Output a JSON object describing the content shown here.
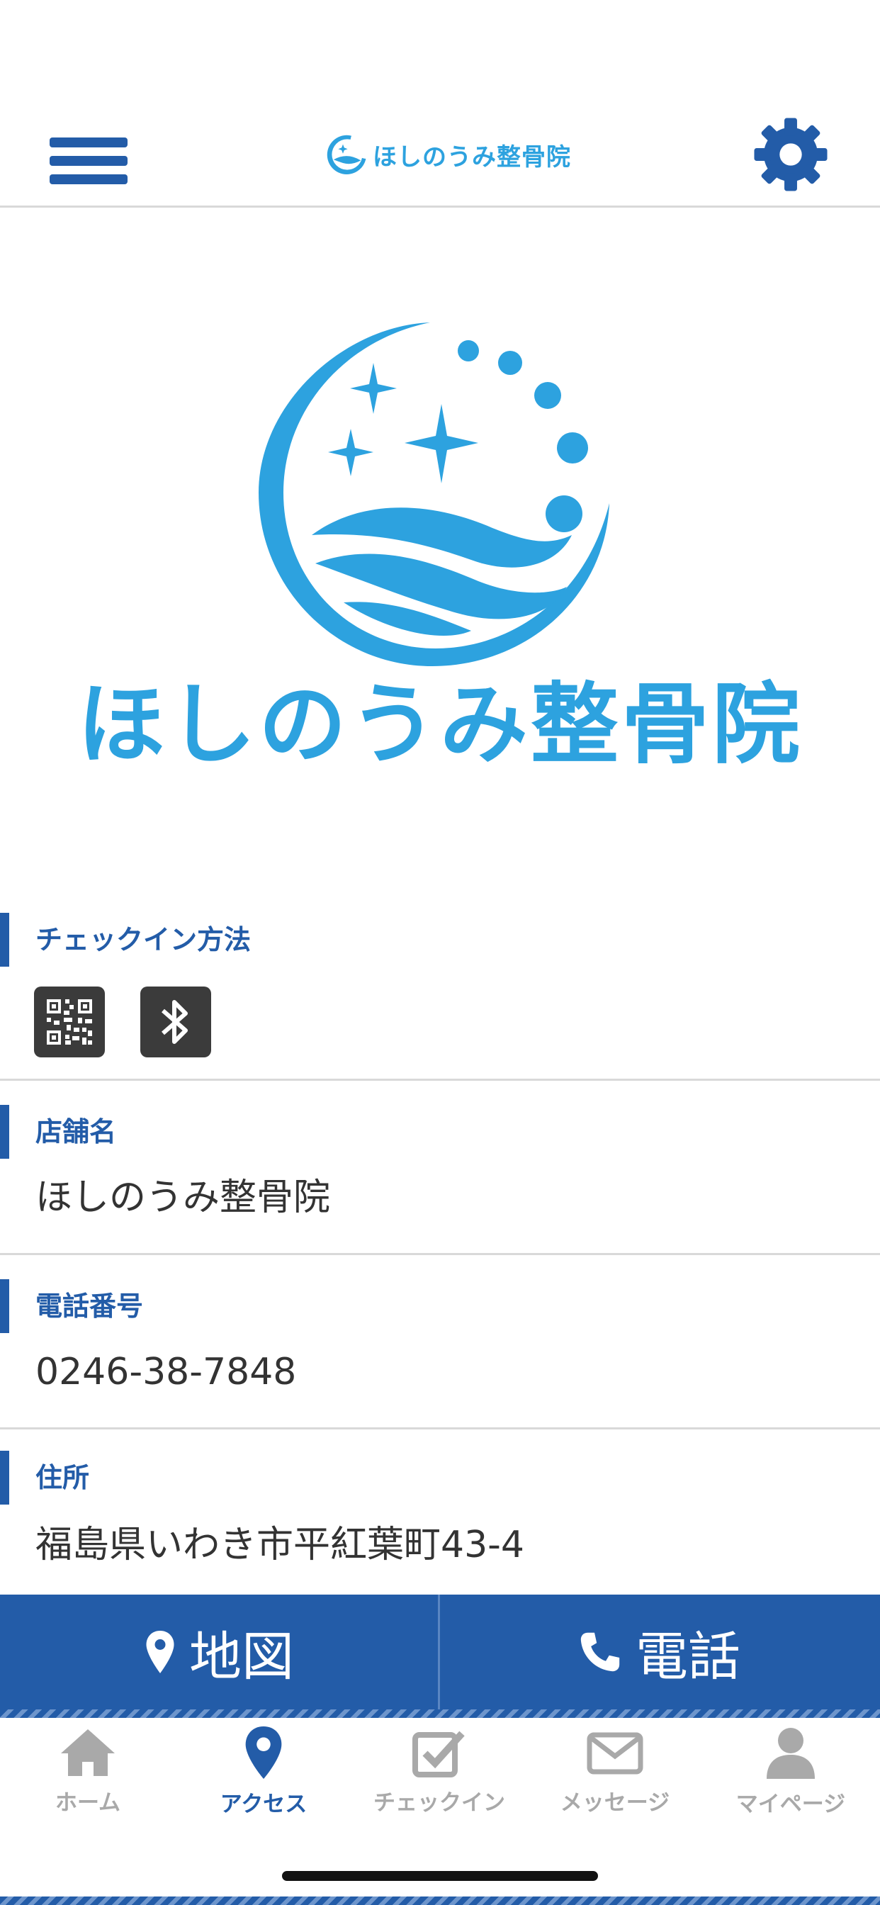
{
  "header": {
    "logo_text": "ほしのうみ整骨院"
  },
  "hero": {
    "clinic_name": "ほしのうみ整骨院"
  },
  "sections": {
    "checkin": {
      "label": "チェックイン方法",
      "methods": [
        "qr-code-icon",
        "bluetooth-icon"
      ]
    },
    "store_name": {
      "label": "店舗名",
      "value": "ほしのうみ整骨院"
    },
    "phone": {
      "label": "電話番号",
      "value": "0246-38-7848"
    },
    "address": {
      "label": "住所",
      "value": "福島県いわき市平紅葉町43-4"
    }
  },
  "actions": {
    "map_label": "地図",
    "call_label": "電話"
  },
  "tabs": [
    {
      "label": "ホーム",
      "icon": "home-icon",
      "active": false
    },
    {
      "label": "アクセス",
      "icon": "map-pin-icon",
      "active": true
    },
    {
      "label": "チェックイン",
      "icon": "checkbox-icon",
      "active": false
    },
    {
      "label": "メッセージ",
      "icon": "envelope-icon",
      "active": false
    },
    {
      "label": "マイページ",
      "icon": "person-icon",
      "active": false
    }
  ],
  "colors": {
    "primary": "#235ca8",
    "logo_blue": "#2da2df",
    "inactive_tab": "#a9a9a9"
  }
}
